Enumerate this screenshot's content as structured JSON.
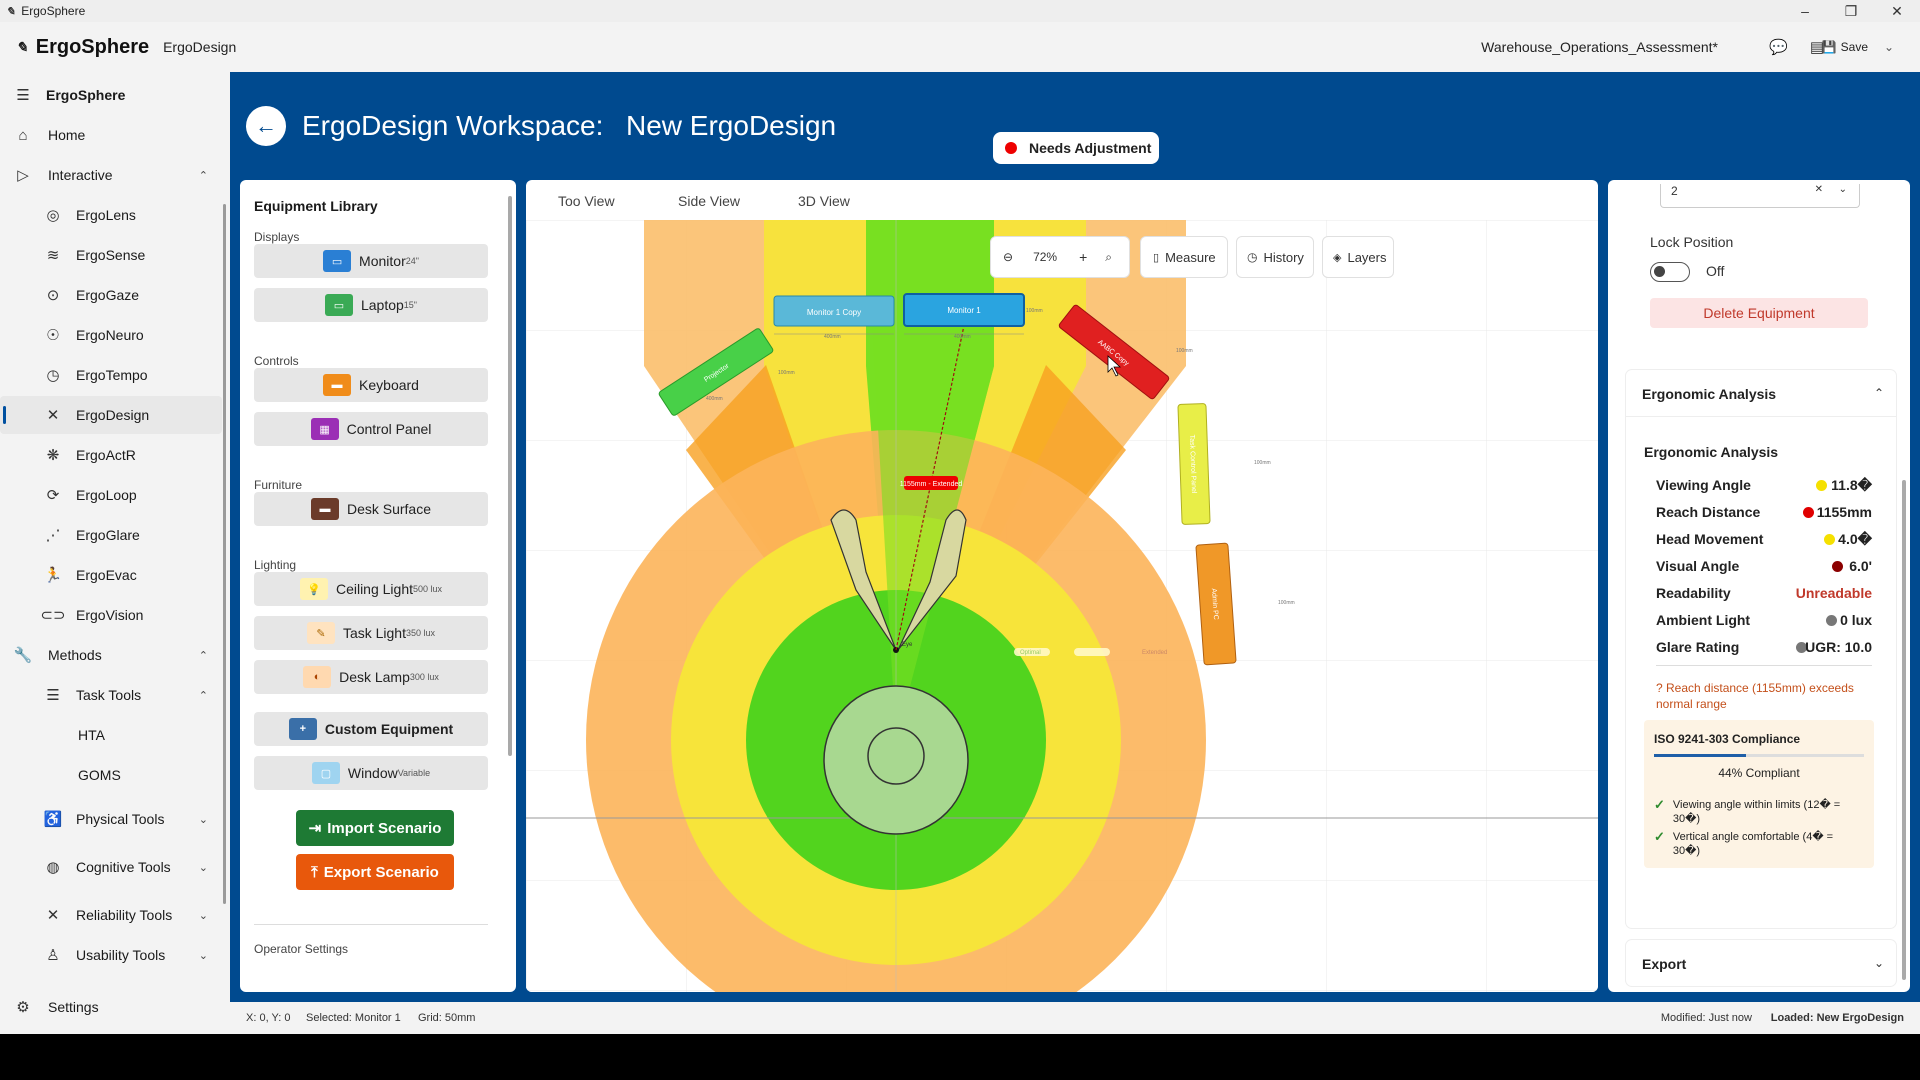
{
  "window": {
    "title": "ErgoSphere",
    "controls": [
      "–",
      "❐",
      "✕"
    ]
  },
  "appbar": {
    "brand": "ErgoSphere",
    "module": "ErgoDesign",
    "document": "Warehouse_Operations_Assessment*",
    "save_label": "Save"
  },
  "sidebar": {
    "header": "ErgoSphere",
    "home": "Home",
    "interactive": "Interactive",
    "tools": [
      "ErgoLens",
      "ErgoSense",
      "ErgoGaze",
      "ErgoNeuro",
      "ErgoTempo",
      "ErgoDesign",
      "ErgoActR",
      "ErgoLoop",
      "ErgoGlare",
      "ErgoEvac",
      "ErgoVision"
    ],
    "methods": "Methods",
    "task_tools": "Task Tools",
    "task_sub": [
      "HTA",
      "GOMS"
    ],
    "physical": "Physical Tools",
    "cognitive": "Cognitive Tools",
    "reliability": "Reliability Tools",
    "usability": "Usability Tools",
    "settings": "Settings"
  },
  "workspace": {
    "title": "ErgoDesign Workspace:",
    "name": "New ErgoDesign",
    "status": "Needs Adjustment",
    "status_color": "#e00000"
  },
  "library": {
    "title": "Equipment Library",
    "cat_displays": "Displays",
    "cat_controls": "Controls",
    "cat_furniture": "Furniture",
    "cat_lighting": "Lighting",
    "monitor": "Monitor",
    "monitor_sup": "24\"",
    "laptop": "Laptop",
    "laptop_sup": "15\"",
    "keyboard": "Keyboard",
    "control_panel": "Control Panel",
    "desk": "Desk Surface",
    "ceiling": "Ceiling Light",
    "ceiling_sup": "500 lux",
    "task": "Task Light",
    "task_sup": "350 lux",
    "lamp": "Desk Lamp",
    "lamp_sup": "300 lux",
    "custom": "Custom Equipment",
    "window": "Window",
    "window_sup": "Variable",
    "import": "Import Scenario",
    "export": "Export Scenario",
    "operator": "Operator Settings"
  },
  "views": {
    "top": "Too View",
    "side": "Side View",
    "three_d": "3D View"
  },
  "toolbar": {
    "zoom": "72%",
    "measure": "Measure",
    "history": "History",
    "layers": "Layers"
  },
  "canvas": {
    "monitor1": "Monitor 1",
    "monitor1_copy": "Monitor 1 Copy",
    "projector": "Projector",
    "aabc_copy": "AABC Copy",
    "task_panel": "Task Control Panel",
    "admin_pc": "Admin PC",
    "reach_label": "1155mm - Extended",
    "eye_label": "Eye",
    "optimal": "Optimal",
    "extended": "Extended",
    "dim_400": "400mm",
    "dim_100": "100mm",
    "dim_80": "80mm"
  },
  "props": {
    "dropdown_value": "2",
    "lock_label": "Lock Position",
    "lock_state": "Off",
    "delete": "Delete Equipment"
  },
  "analysis": {
    "section": "Ergonomic Analysis",
    "title": "Ergonomic Analysis",
    "metrics": [
      {
        "label": "Viewing Angle",
        "value": "11.8�",
        "color": "#f5e000"
      },
      {
        "label": "Reach Distance",
        "value": "1155mm",
        "color": "#e00000"
      },
      {
        "label": "Head Movement",
        "value": "4.0�",
        "color": "#f5e000"
      },
      {
        "label": "Visual Angle",
        "value": "6.0'",
        "color": "#8b0000"
      },
      {
        "label": "Readability",
        "value": "Unreadable",
        "color": "#c0392b"
      },
      {
        "label": "Ambient Light",
        "value": "0 lux",
        "color": "#777777"
      },
      {
        "label": "Glare Rating",
        "value": "UGR: 10.0",
        "color": "#777777"
      }
    ],
    "warning": "? Reach distance (1155mm) exceeds normal range",
    "iso_title": "ISO 9241-303 Compliance",
    "iso_percent": 44,
    "iso_pct_text": "44% Compliant",
    "iso_check1": "Viewing angle within limits (12� = 30�)",
    "iso_check2": "Vertical angle comfortable (4� = 30�)",
    "export": "Export"
  },
  "status": {
    "coords": "X: 0, Y: 0",
    "selected": "Selected: Monitor 1",
    "grid": "Grid: 50mm",
    "modified": "Modified: Just now",
    "loaded": "Loaded: New ErgoDesign"
  }
}
